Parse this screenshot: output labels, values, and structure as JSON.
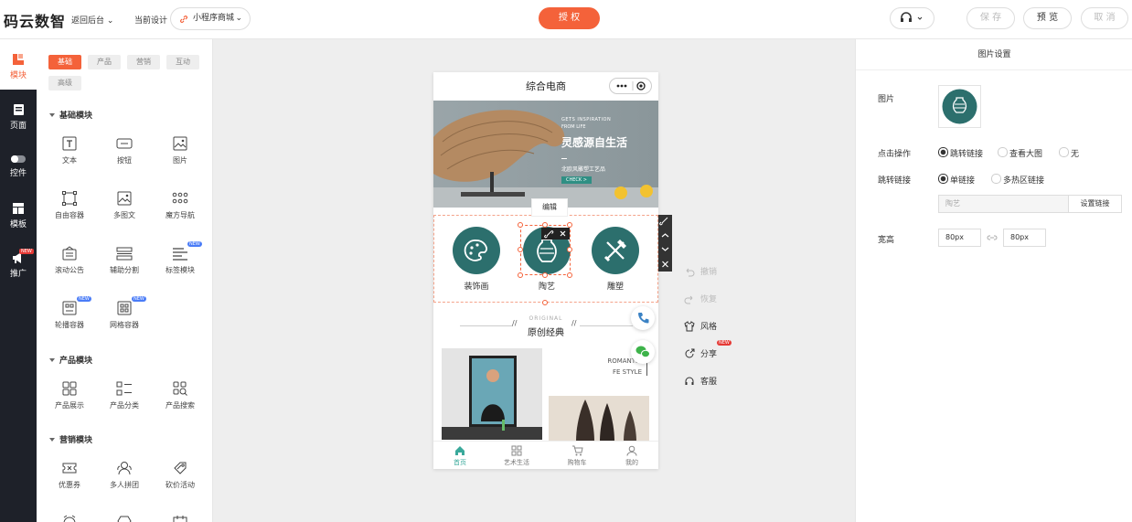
{
  "header": {
    "logo": "码云数智",
    "back_label": "返回后台",
    "current_design_label": "当前设计",
    "current_design_value": "小程序商城",
    "authorize_label": "授 权",
    "save_label": "保 存",
    "preview_label": "预 览",
    "cancel_label": "取 消"
  },
  "sidebar": {
    "items": [
      {
        "label": "模块",
        "icon": "module-icon",
        "active": true
      },
      {
        "label": "页面",
        "icon": "page-icon"
      },
      {
        "label": "控件",
        "icon": "toggle-icon"
      },
      {
        "label": "模板",
        "icon": "template-icon"
      },
      {
        "label": "推广",
        "icon": "megaphone-icon",
        "badge": "NEW"
      }
    ]
  },
  "library": {
    "tabs": [
      "基础",
      "产品",
      "营销",
      "互动",
      "高级"
    ],
    "active_tab": "基础",
    "sections": [
      {
        "title": "基础模块",
        "items": [
          {
            "label": "文本",
            "icon": "text-icon"
          },
          {
            "label": "按钮",
            "icon": "button-icon"
          },
          {
            "label": "图片",
            "icon": "image-icon"
          },
          {
            "label": "自由容器",
            "icon": "free-container-icon"
          },
          {
            "label": "多图文",
            "icon": "multi-image-text-icon"
          },
          {
            "label": "魔方导航",
            "icon": "grid-nav-icon"
          },
          {
            "label": "滚动公告",
            "icon": "notice-icon"
          },
          {
            "label": "辅助分割",
            "icon": "divider-icon"
          },
          {
            "label": "标签模块",
            "icon": "tag-module-icon",
            "badge": "NEW"
          },
          {
            "label": "轮播容器",
            "icon": "carousel-container-icon",
            "badge": "NEW"
          },
          {
            "label": "网格容器",
            "icon": "grid-container-icon",
            "badge": "NEW"
          }
        ]
      },
      {
        "title": "产品模块",
        "items": [
          {
            "label": "产品展示",
            "icon": "product-display-icon"
          },
          {
            "label": "产品分类",
            "icon": "product-category-icon"
          },
          {
            "label": "产品搜索",
            "icon": "product-search-icon"
          }
        ]
      },
      {
        "title": "营销模块",
        "items": [
          {
            "label": "优惠券",
            "icon": "coupon-icon"
          },
          {
            "label": "多人拼团",
            "icon": "group-buy-icon"
          },
          {
            "label": "砍价活动",
            "icon": "bargain-icon"
          }
        ]
      }
    ]
  },
  "canvas": {
    "page_title": "综合电商",
    "banner": {
      "line1": "GETS INSPIRATION",
      "line2": "FROM LIFE",
      "headline": "灵感源自生活",
      "subline": "北欧风雕塑工艺品",
      "button": "CHECK >"
    },
    "edit_tooltip": "编辑",
    "categories": [
      {
        "label": "装饰画",
        "icon": "palette-icon"
      },
      {
        "label": "陶艺",
        "icon": "vase-icon"
      },
      {
        "label": "雕塑",
        "icon": "tools-icon"
      }
    ],
    "section_title_en": "ORIGINAL",
    "section_title_cn": "原创经典",
    "section_title_slashes": "//",
    "romantic_text_line1": "ROMANTIC",
    "romantic_text_line2": "FE STYLE",
    "tabbar": [
      {
        "label": "首页",
        "icon": "home-icon",
        "active": true
      },
      {
        "label": "艺术生活",
        "icon": "grid-icon"
      },
      {
        "label": "购物车",
        "icon": "cart-icon"
      },
      {
        "label": "我的",
        "icon": "user-icon"
      }
    ]
  },
  "operations": [
    {
      "label": "撤销",
      "icon": "undo-icon",
      "disabled": true
    },
    {
      "label": "恢复",
      "icon": "redo-icon",
      "disabled": true
    },
    {
      "label": "风格",
      "icon": "shirt-icon"
    },
    {
      "label": "分享",
      "icon": "share-icon",
      "badge": "NEW"
    },
    {
      "label": "客服",
      "icon": "headset-icon"
    }
  ],
  "settings": {
    "title": "图片设置",
    "image_label": "图片",
    "click_label": "点击操作",
    "click_options": [
      "跳转链接",
      "查看大图",
      "无"
    ],
    "click_selected": "跳转链接",
    "link_label": "跳转链接",
    "link_options": [
      "单链接",
      "多热区链接"
    ],
    "link_selected": "单链接",
    "link_value": "陶艺",
    "link_button": "设置链接",
    "size_label": "宽高",
    "width": "80px",
    "height": "80px"
  },
  "colors": {
    "accent": "#f4623a",
    "teal": "#2c6f6d",
    "nav_bg": "#1e2129"
  }
}
